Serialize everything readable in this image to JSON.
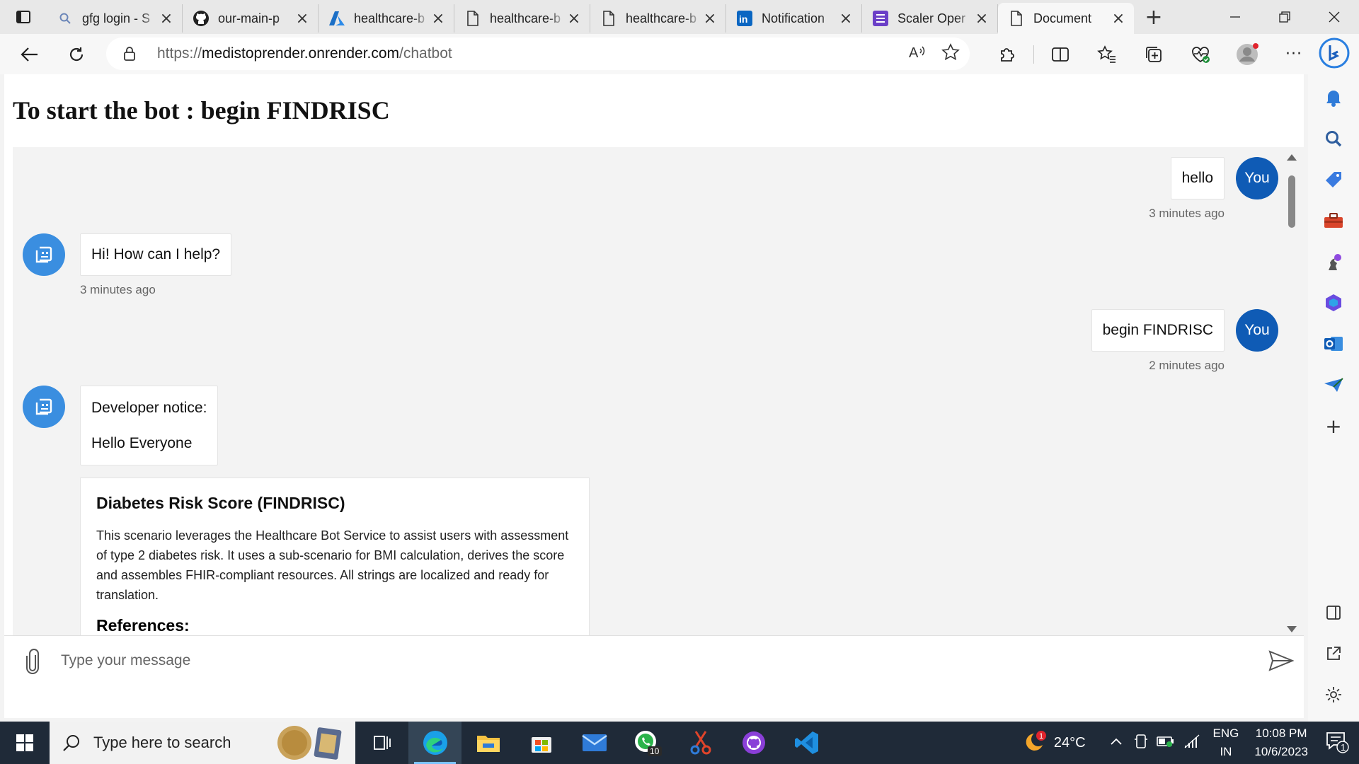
{
  "browser": {
    "tabs": [
      {
        "label": "gfg login - S",
        "icon": "search-icon"
      },
      {
        "label": "our-main-p",
        "icon": "github-icon"
      },
      {
        "label": "healthcare-b",
        "icon": "azure-icon"
      },
      {
        "label": "healthcare-b",
        "icon": "document-icon"
      },
      {
        "label": "healthcare-b",
        "icon": "document-icon"
      },
      {
        "label": "Notification",
        "icon": "linkedin-icon"
      },
      {
        "label": "Scaler Oper",
        "icon": "scaler-icon"
      },
      {
        "label": "Document",
        "icon": "document-icon",
        "active": true
      }
    ],
    "url_scheme": "https://",
    "url_host": "medistoprender.onrender.com",
    "url_path": "/chatbot"
  },
  "page": {
    "heading": "To start the bot : begin FINDRISC"
  },
  "chat": {
    "messages": [
      {
        "from": "user",
        "text": "hello",
        "avatar": "You",
        "time": "3 minutes ago"
      },
      {
        "from": "bot",
        "text": "Hi! How can I help?",
        "time": "3 minutes ago"
      },
      {
        "from": "user",
        "text": "begin FINDRISC",
        "avatar": "You",
        "time": "2 minutes ago"
      },
      {
        "from": "bot",
        "lines": [
          "Developer notice:",
          "Hello Everyone"
        ]
      }
    ],
    "card": {
      "title": "Diabetes Risk Score (FINDRISC)",
      "body": "This scenario leverages the Healthcare Bot Service to assist users with assessment of type 2 diabetes risk. It uses a sub-scenario for BMI calculation, derives the score and assembles FHIR-compliant resources. All strings are localized and ready for translation.",
      "references_heading": "References:"
    },
    "input_placeholder": "Type your message"
  },
  "taskbar": {
    "search_placeholder": "Type here to search",
    "weather_temp": "24°C",
    "weather_badge": "1",
    "lang_top": "ENG",
    "lang_bottom": "IN",
    "time": "10:08 PM",
    "date": "10/6/2023",
    "notifications_count": "1",
    "whatsapp_badge": "10"
  },
  "colors": {
    "you_avatar": "#0f5bb5",
    "bot_avatar": "#3a8ee0",
    "taskbar": "#1f2a38"
  }
}
